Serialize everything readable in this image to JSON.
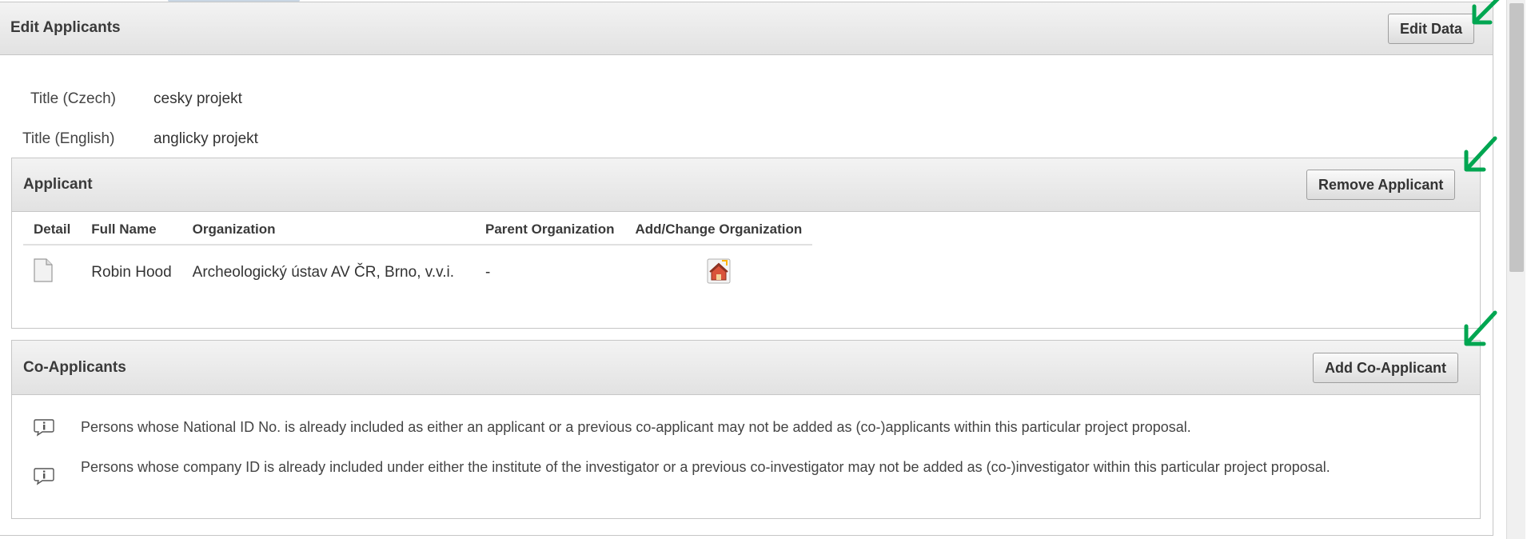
{
  "edit_applicants": {
    "title": "Edit Applicants",
    "edit_button": "Edit Data",
    "fields": [
      {
        "label": "Title (Czech)",
        "value": "cesky projekt"
      },
      {
        "label": "Title (English)",
        "value": "anglicky projekt"
      }
    ]
  },
  "applicant": {
    "title": "Applicant",
    "remove_button": "Remove Applicant",
    "columns": [
      "Detail",
      "Full Name",
      "Organization",
      "Parent Organization",
      "Add/Change Organization"
    ],
    "rows": [
      {
        "detail_icon": "document-icon",
        "full_name": "Robin Hood",
        "organization": "Archeologický ústav AV ČR, Brno, v.v.i.",
        "parent_organization": "-",
        "change_icon": "organization-icon"
      }
    ]
  },
  "co_applicants": {
    "title": "Co-Applicants",
    "add_button": "Add Co-Applicant",
    "notes": [
      "Persons whose National ID No. is already included as either an applicant or a previous co-applicant may not be added as (co-)applicants within this particular project proposal.",
      "Persons whose company ID is already included under either the institute of the investigator or a previous co-investigator may not be added as (co-)investigator within this particular project proposal."
    ],
    "note_icon": "info-icon"
  },
  "colors": {
    "header_gradient_top": "#f3f3f3",
    "header_gradient_bottom": "#e2e2e2",
    "border": "#c6c6c6",
    "annotation_arrow": "#00a651"
  }
}
